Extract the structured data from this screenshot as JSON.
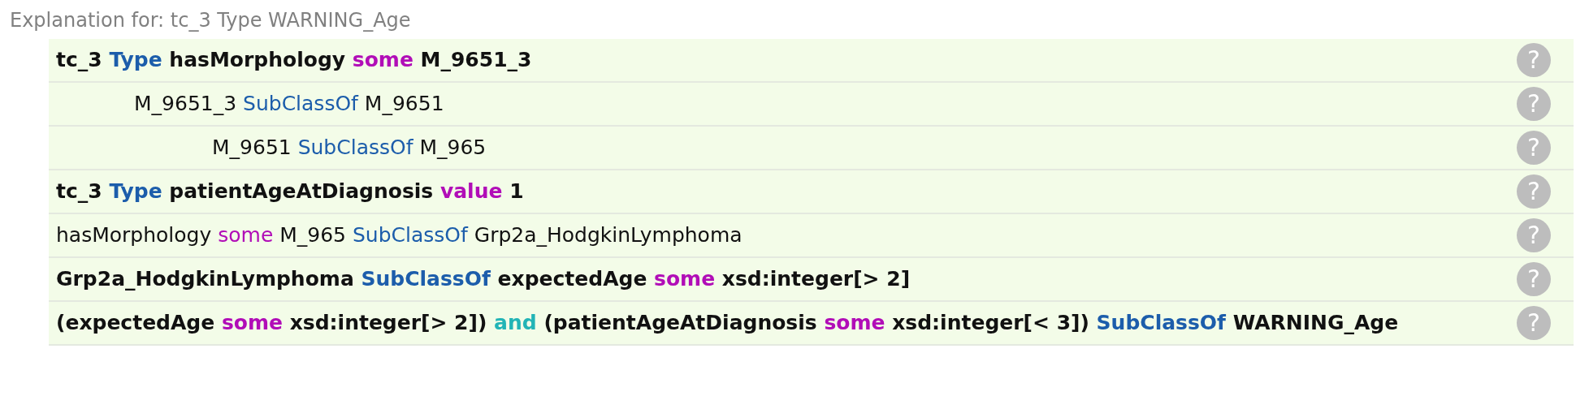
{
  "title": "Explanation for: tc_3 Type WARNING_Age",
  "axioms": [
    {
      "bold": true,
      "help": "?",
      "tokens": [
        {
          "text": "tc_3",
          "kind": "plain"
        },
        {
          "text": "Type",
          "kind": "keyword"
        },
        {
          "text": "hasMorphology",
          "kind": "plain"
        },
        {
          "text": "some",
          "kind": "quantifier"
        },
        {
          "text": "M_9651_3",
          "kind": "plain"
        }
      ],
      "children": [
        {
          "bold": false,
          "help": "?",
          "tokens": [
            {
              "text": "M_9651_3",
              "kind": "plain"
            },
            {
              "text": "SubClassOf",
              "kind": "keyword"
            },
            {
              "text": "M_9651",
              "kind": "plain"
            }
          ],
          "children": [
            {
              "bold": false,
              "help": "?",
              "tokens": [
                {
                  "text": "M_9651",
                  "kind": "plain"
                },
                {
                  "text": "SubClassOf",
                  "kind": "keyword"
                },
                {
                  "text": "M_965",
                  "kind": "plain"
                }
              ]
            }
          ]
        }
      ]
    },
    {
      "bold": true,
      "help": "?",
      "tokens": [
        {
          "text": "tc_3",
          "kind": "plain"
        },
        {
          "text": "Type",
          "kind": "keyword"
        },
        {
          "text": "patientAgeAtDiagnosis",
          "kind": "plain"
        },
        {
          "text": "value",
          "kind": "quantifier"
        },
        {
          "text": "1",
          "kind": "plain"
        }
      ]
    },
    {
      "bold": false,
      "help": "?",
      "tokens": [
        {
          "text": "hasMorphology",
          "kind": "plain"
        },
        {
          "text": "some",
          "kind": "quantifier"
        },
        {
          "text": "M_965",
          "kind": "plain"
        },
        {
          "text": "SubClassOf",
          "kind": "keyword"
        },
        {
          "text": "Grp2a_HodgkinLymphoma",
          "kind": "plain"
        }
      ]
    },
    {
      "bold": true,
      "help": "?",
      "tokens": [
        {
          "text": "Grp2a_HodgkinLymphoma",
          "kind": "plain"
        },
        {
          "text": "SubClassOf",
          "kind": "keyword"
        },
        {
          "text": "expectedAge",
          "kind": "plain"
        },
        {
          "text": "some",
          "kind": "quantifier"
        },
        {
          "text": "xsd:integer[> 2]",
          "kind": "plain"
        }
      ]
    },
    {
      "bold": true,
      "help": "?",
      "tokens": [
        {
          "text": "(expectedAge",
          "kind": "plain"
        },
        {
          "text": "some",
          "kind": "quantifier"
        },
        {
          "text": "xsd:integer[> 2])",
          "kind": "plain"
        },
        {
          "text": "and",
          "kind": "connective"
        },
        {
          "text": "(patientAgeAtDiagnosis",
          "kind": "plain"
        },
        {
          "text": "some",
          "kind": "quantifier"
        },
        {
          "text": "xsd:integer[< 3])",
          "kind": "plain"
        },
        {
          "text": "SubClassOf",
          "kind": "keyword"
        },
        {
          "text": "WARNING_Age",
          "kind": "plain"
        }
      ]
    }
  ]
}
